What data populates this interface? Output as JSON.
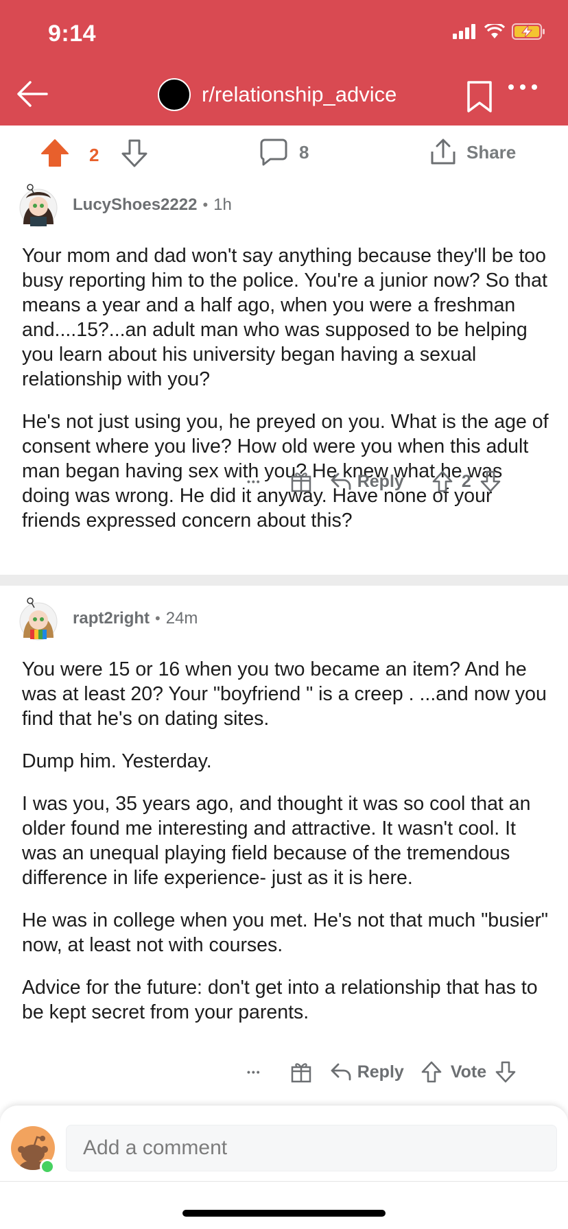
{
  "status_bar": {
    "time": "9:14",
    "icons": [
      "signal-icon",
      "wifi-icon",
      "battery-charging-icon"
    ]
  },
  "header": {
    "subreddit": "r/relationship_advice",
    "back_icon": "back-arrow-icon",
    "bookmark_icon": "bookmark-icon",
    "more_icon": "more-icon",
    "brand_color": "#d94a52"
  },
  "post_actions": {
    "score": "2",
    "comments": "8",
    "share_label": "Share",
    "upvote_color": "#e8602c"
  },
  "comments": [
    {
      "username": "LucyShoes2222",
      "separator": "•",
      "time": "1h",
      "paragraphs": [
        "Your mom and dad won't say anything because they'll be too busy reporting him to the police. You're a junior now? So that means a year and a half ago, when you were a freshman and....15?...an adult man who was supposed to be helping you learn about his university began having a sexual relationship with you?",
        "He's not just using you, he preyed on you. What is the age of consent where you live? How old were you when this adult man began having sex with you? He knew what he was doing was wrong. He did it anyway.  Have none of your friends expressed concern about this?"
      ],
      "more_label": "•••",
      "reply_label": "Reply",
      "score": "2"
    },
    {
      "username": "rapt2right",
      "separator": "•",
      "time": "24m",
      "paragraphs": [
        "You were 15 or 16 when you two became an item?  And he was at least 20? Your \"boyfriend \" is a creep . ...and now you find that he's on dating sites.",
        "Dump him. Yesterday.",
        "I was you,  35 years ago,  and thought it was so cool that an older found me interesting and attractive.  It wasn't cool. It was an unequal playing field because of the tremendous difference in life experience- just as it is here.",
        "He was in college when you met. He's not that much \"busier\" now, at least not with courses.",
        "Advice for the future: don't get into a relationship that has to be kept secret from your parents."
      ],
      "more_label": "•••",
      "reply_label": "Reply",
      "score": "Vote"
    }
  ],
  "composer": {
    "placeholder": "Add a comment",
    "online_color": "#46d160"
  }
}
